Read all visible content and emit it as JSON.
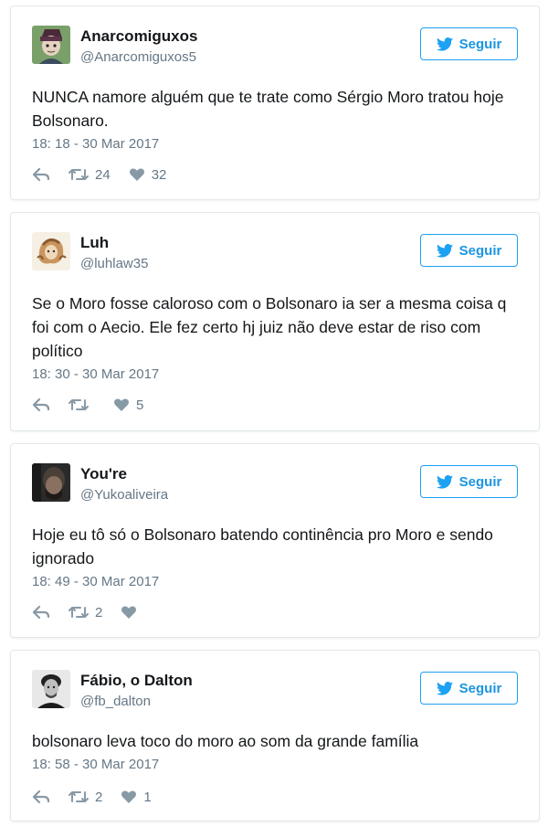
{
  "follow_label": "Seguir",
  "accent": "#1da1f2",
  "tweets": [
    {
      "name": "Anarcomiguxos",
      "handle": "@Anarcomiguxos5",
      "text": "NUNCA namore alguém que te trate como Sérgio Moro tratou hoje Bolsonaro.",
      "time": "18: 18 - 30 Mar 2017",
      "retweets": "24",
      "likes": "32"
    },
    {
      "name": "Luh",
      "handle": "@luhlaw35",
      "text": "Se o Moro fosse caloroso com o Bolsonaro ia ser a mesma coisa q foi com o Aecio. Ele fez certo hj juiz não deve estar de riso com político",
      "time": "18: 30 - 30 Mar 2017",
      "retweets": "",
      "likes": "5"
    },
    {
      "name": "You're",
      "handle": "@Yukoaliveira",
      "text": "Hoje eu tô só o Bolsonaro batendo continência pro Moro e sendo ignorado",
      "time": "18: 49 - 30 Mar 2017",
      "retweets": "2",
      "likes": ""
    },
    {
      "name": "Fábio, o Dalton",
      "handle": "@fb_dalton",
      "text": "bolsonaro leva toco do moro ao som da grande família",
      "time": "18: 58 - 30 Mar 2017",
      "retweets": "2",
      "likes": "1"
    }
  ]
}
